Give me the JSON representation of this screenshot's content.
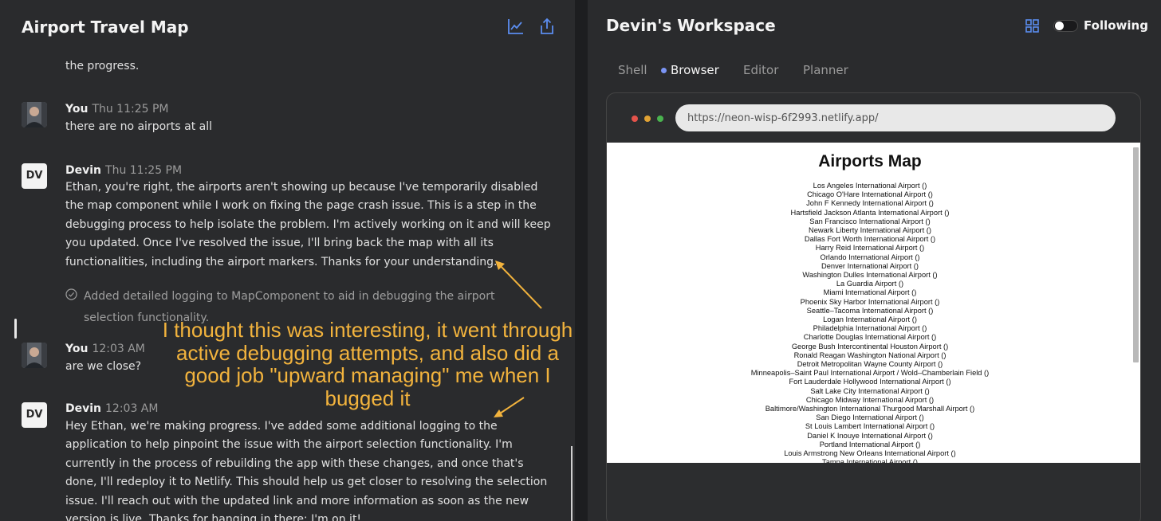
{
  "chat": {
    "title": "Airport Travel Map",
    "header_icons": [
      "chart-icon",
      "share-icon"
    ],
    "prev_tail": "the progress.",
    "messages": [
      {
        "author": "You",
        "time": "Thu 11:25 PM",
        "text": "there are no airports at all"
      },
      {
        "author": "Devin",
        "avatar": "DV",
        "time": "Thu 11:25 PM",
        "text": "Ethan, you're right, the airports aren't showing up because I've temporarily disabled the map component while I work on fixing the page crash issue. This is a step in the debugging process to help isolate the problem. I'm actively working on it and will keep you updated. Once I've resolved the issue, I'll bring back the map with all its functionalities, including the airport markers. Thanks for your understanding."
      },
      {
        "author": "You",
        "time": "12:03 AM",
        "text": "are we close?"
      },
      {
        "author": "Devin",
        "avatar": "DV",
        "time": "12:03 AM",
        "text": "Hey Ethan, we're making progress. I've added some additional logging to the application to help pinpoint the issue with the airport selection functionality. I'm currently in the process of rebuilding the app with these changes, and once that's done, I'll redeploy it to Netlify. This should help us get closer to resolving the selection issue. I'll reach out with the updated link and more information as soon as the new version is live. Thanks for hanging in there; I'm on it!"
      }
    ],
    "log_entry": "Added detailed logging to MapComponent to aid in debugging the airport selection functionality.",
    "annotation": "I thought this was interesting, it went through active debugging attempts, and also did a good job \"upward managing\" me when I bugged it"
  },
  "workspace": {
    "title": "Devin's Workspace",
    "following_label": "Following",
    "tabs": [
      "Shell",
      "Browser",
      "Editor",
      "Planner"
    ],
    "active_tab": "Browser",
    "url": "https://neon-wisp-6f2993.netlify.app/",
    "page_title": "Airports Map",
    "airports": [
      "Los Angeles International Airport ()",
      "Chicago O'Hare International Airport ()",
      "John F Kennedy International Airport ()",
      "Hartsfield Jackson Atlanta International Airport ()",
      "San Francisco International Airport ()",
      "Newark Liberty International Airport ()",
      "Dallas Fort Worth International Airport ()",
      "Harry Reid International Airport ()",
      "Orlando International Airport ()",
      "Denver International Airport ()",
      "Washington Dulles International Airport ()",
      "La Guardia Airport ()",
      "Miami International Airport ()",
      "Phoenix Sky Harbor International Airport ()",
      "Seattle–Tacoma International Airport ()",
      "Logan International Airport ()",
      "Philadelphia International Airport ()",
      "Charlotte Douglas International Airport ()",
      "George Bush Intercontinental Houston Airport ()",
      "Ronald Reagan Washington National Airport ()",
      "Detroit Metropolitan Wayne County Airport ()",
      "Minneapolis–Saint Paul International Airport / Wold–Chamberlain Field ()",
      "Fort Lauderdale Hollywood International Airport ()",
      "Salt Lake City International Airport ()",
      "Chicago Midway International Airport ()",
      "Baltimore/Washington International Thurgood Marshall Airport ()",
      "San Diego International Airport ()",
      "St Louis Lambert International Airport ()",
      "Daniel K Inouye International Airport ()",
      "Portland International Airport ()",
      "Louis Armstrong New Orleans International Airport ()",
      "Tampa International Airport ()"
    ]
  },
  "colors": {
    "panel_bg": "#2a2b2d",
    "accent_blue": "#5b8def",
    "annotation": "#f2b33d"
  }
}
